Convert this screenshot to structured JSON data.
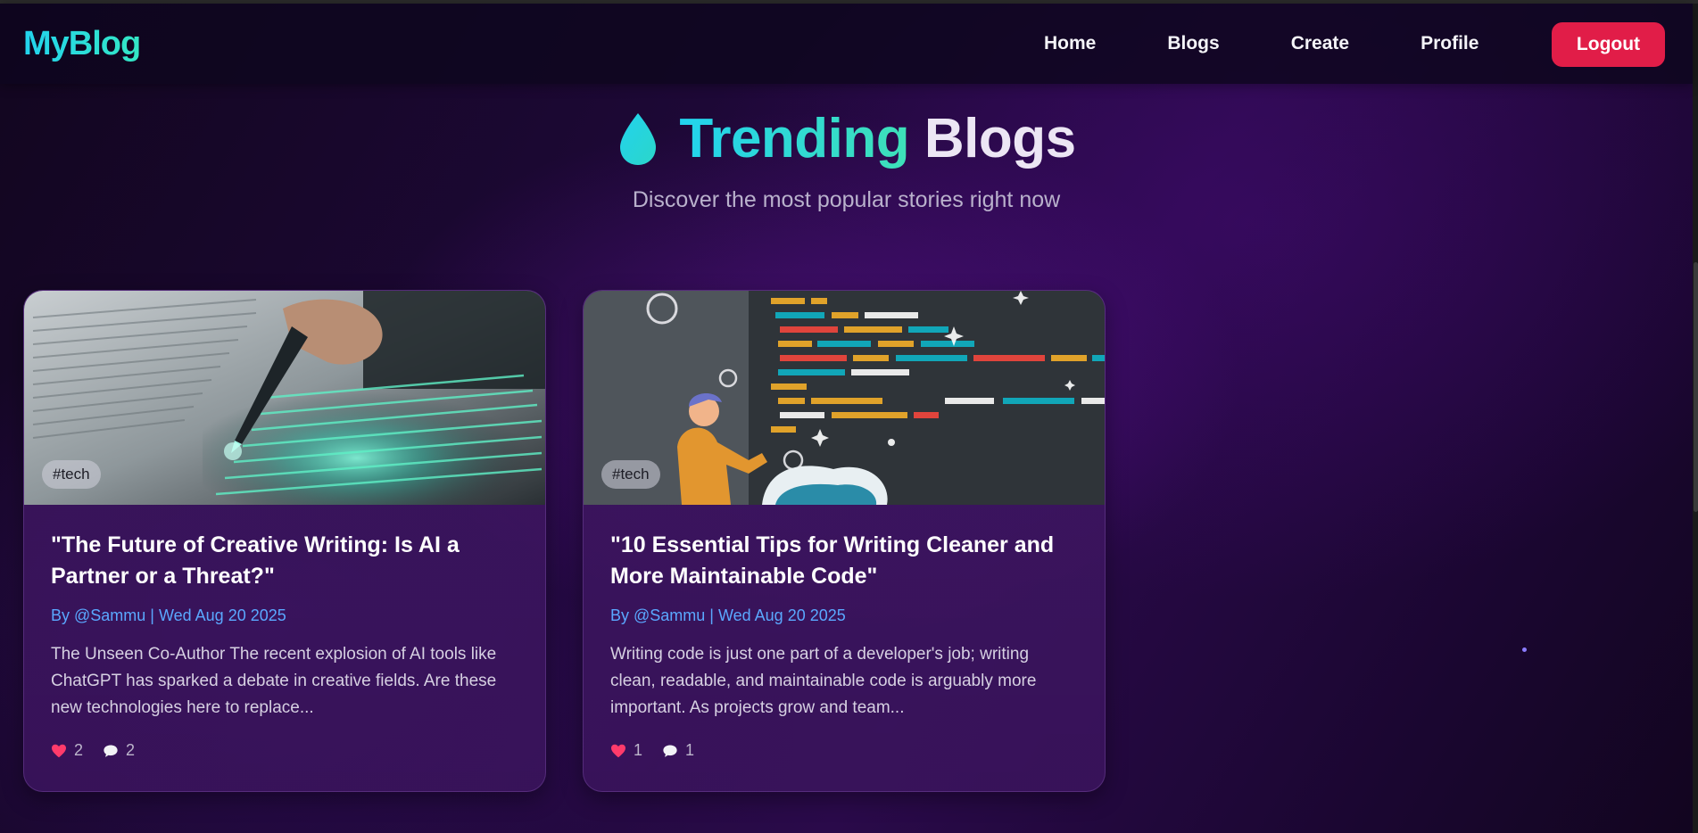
{
  "app": {
    "logo": "MyBlog"
  },
  "nav": {
    "links": [
      "Home",
      "Blogs",
      "Create",
      "Profile"
    ],
    "logout_label": "Logout"
  },
  "hero": {
    "title_accent": "Trending",
    "title_rest": "Blogs",
    "subtitle": "Discover the most popular stories right now"
  },
  "posts": [
    {
      "tag": "#tech",
      "title": "\"The Future of Creative Writing: Is AI a Partner or a Threat?\"",
      "meta": "By @Sammu | Wed Aug 20 2025",
      "excerpt": "The Unseen Co-Author The recent explosion of AI tools like ChatGPT has sparked a debate in creative fields. Are these new technologies here to replace...",
      "likes": "2",
      "comments": "2"
    },
    {
      "tag": "#tech",
      "title": "\"10 Essential Tips for Writing Cleaner and More Maintainable Code\"",
      "meta": "By @Sammu | Wed Aug 20 2025",
      "excerpt": "Writing code is just one part of a developer's job; writing clean, readable, and maintainable code is arguably more important. As projects grow and team...",
      "likes": "1",
      "comments": "1"
    }
  ],
  "icons": {
    "hero": "drop-icon",
    "like": "heart-icon",
    "comment": "comment-bubble-icon"
  },
  "colors": {
    "accent": "#22d3ee",
    "logout": "#e11d48",
    "meta": "#5aa8ff",
    "like": "#ff3b6b"
  }
}
